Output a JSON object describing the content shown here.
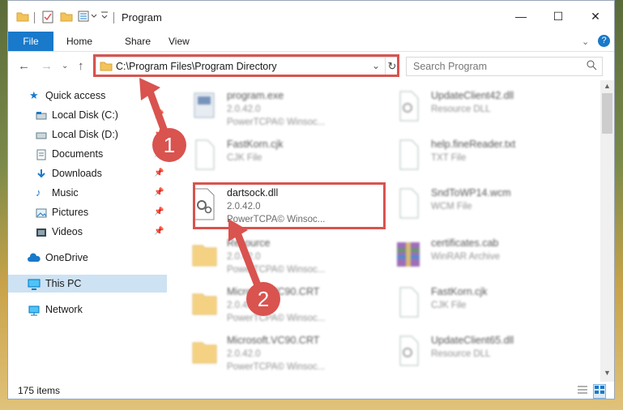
{
  "window": {
    "title": "Program",
    "minimize": "—",
    "maximize": "☐",
    "close": "✕"
  },
  "ribbon": {
    "tabs": [
      "File",
      "Home",
      "Share",
      "View"
    ]
  },
  "address": {
    "path": "C:\\Program Files\\Program Directory",
    "search_placeholder": "Search Program"
  },
  "sidebar": {
    "items": [
      {
        "label": "Quick access",
        "icon": "star-icon"
      },
      {
        "label": "Local Disk (C:)",
        "icon": "drive-icon"
      },
      {
        "label": "Local Disk (D:)",
        "icon": "drive-icon"
      },
      {
        "label": "Documents",
        "icon": "documents-icon"
      },
      {
        "label": "Downloads",
        "icon": "download-icon"
      },
      {
        "label": "Music",
        "icon": "music-icon"
      },
      {
        "label": "Pictures",
        "icon": "pictures-icon"
      },
      {
        "label": "Videos",
        "icon": "videos-icon"
      },
      {
        "label": "OneDrive",
        "icon": "cloud-icon"
      },
      {
        "label": "This PC",
        "icon": "computer-icon"
      },
      {
        "label": "Network",
        "icon": "network-icon"
      }
    ]
  },
  "files": {
    "left": [
      {
        "name": "program.exe",
        "line1": "2.0.42.0",
        "line2": "PowerTCPA© Winsoc..."
      },
      {
        "name": "FastKorn.cjk",
        "line1": "CJK File",
        "line2": ""
      },
      {
        "name": "dartsock.dll",
        "line1": "2.0.42.0",
        "line2": "PowerTCPA© Winsoc..."
      },
      {
        "name": "Resource",
        "line1": "2.0.42.0",
        "line2": "PowerTCPA© Winsoc..."
      },
      {
        "name": "Microsoft.VC90.CRT",
        "line1": "2.0.42.0",
        "line2": "PowerTCPA© Winsoc..."
      },
      {
        "name": "Microsoft.VC90.CRT",
        "line1": "2.0.42.0",
        "line2": "PowerTCPA© Winsoc..."
      }
    ],
    "right": [
      {
        "name": "UpdateClient42.dll",
        "line1": "Resource DLL"
      },
      {
        "name": "help.fineReader.txt",
        "line1": "TXT File"
      },
      {
        "name": "SndToWP14.wcm",
        "line1": "WCM File"
      },
      {
        "name": "certificates.cab",
        "line1": "WinRAR Archive"
      },
      {
        "name": "FastKorn.cjk",
        "line1": "CJK File"
      },
      {
        "name": "UpdateClient65.dll",
        "line1": "Resource DLL"
      }
    ]
  },
  "status": {
    "count": "175 items"
  },
  "callouts": {
    "one": "1",
    "two": "2"
  },
  "colors": {
    "accent": "#1979ca",
    "highlight": "#d9534f",
    "selection": "#cde2f3"
  }
}
